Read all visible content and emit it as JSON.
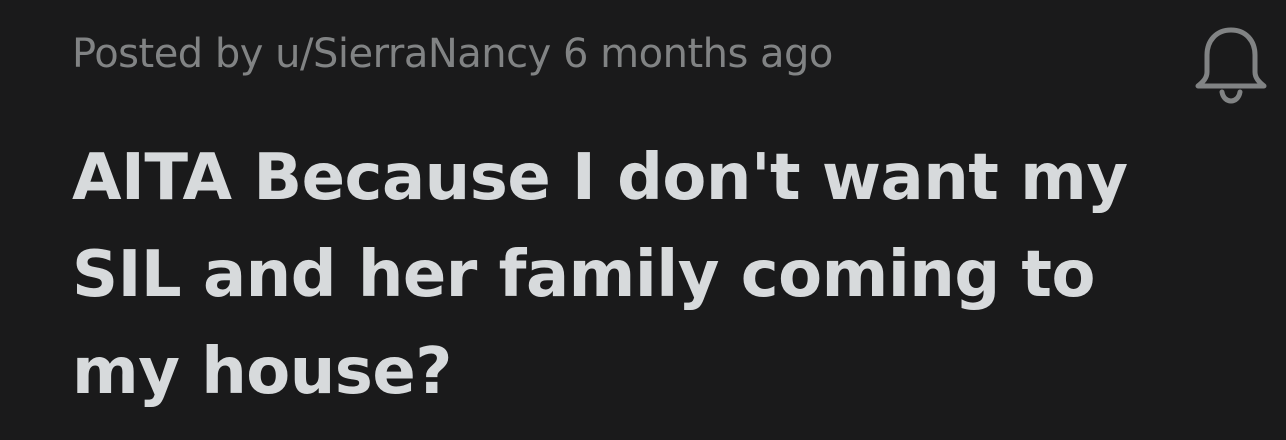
{
  "post": {
    "meta": "Posted by u/SierraNancy 6 months ago",
    "title_lines": [
      "AITA Because I don't want my",
      "SIL and her family coming to",
      "my house?"
    ],
    "notify_icon": "bell-icon"
  },
  "colors": {
    "background": "#1a1a1b",
    "meta_text": "#818384",
    "title_text": "#d7dadc"
  }
}
